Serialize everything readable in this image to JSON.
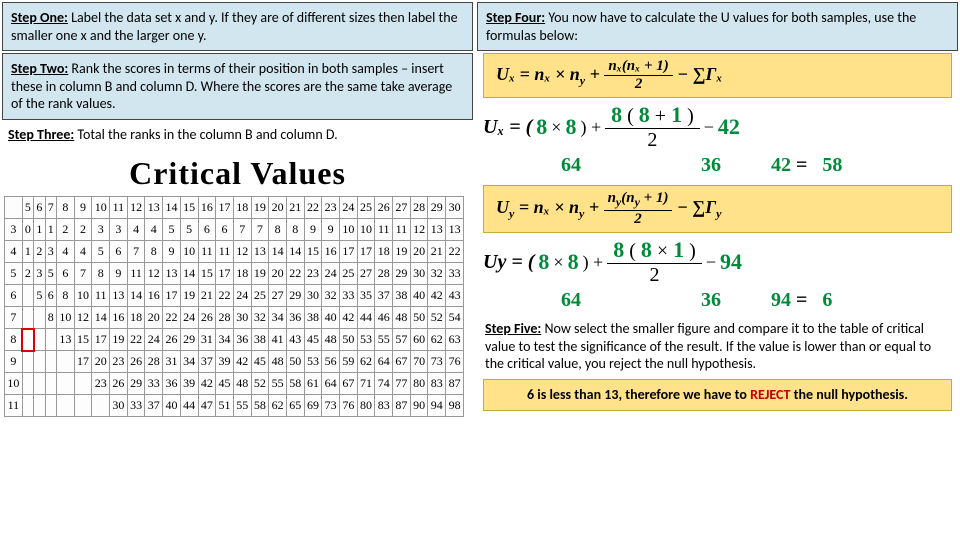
{
  "left": {
    "step1": {
      "label": "Step One:",
      "text": " Label the data set x and y. If they are of different sizes then label the smaller one x and the larger one y."
    },
    "step2": {
      "label": "Step Two:",
      "text": " Rank the scores in terms of their position in both samples – insert these in column B and column D. Where the scores are the same take average of the rank values."
    },
    "step3": {
      "label": "Step Three:",
      "text": " Total the ranks in the column B and column D."
    },
    "critical_title": "Critical Values"
  },
  "table": {
    "header": [
      "5",
      "6",
      "7",
      "8",
      "9",
      "10",
      "11",
      "12",
      "13",
      "14",
      "15",
      "16",
      "17",
      "18",
      "19",
      "20",
      "21",
      "22",
      "23",
      "24",
      "25",
      "26",
      "27",
      "28",
      "29",
      "30"
    ],
    "rows": [
      {
        "h": "3",
        "cells": [
          "0",
          "1",
          "1",
          "2",
          "2",
          "3",
          "3",
          "4",
          "4",
          "5",
          "5",
          "6",
          "6",
          "7",
          "7",
          "8",
          "8",
          "9",
          "9",
          "10",
          "10",
          "11",
          "11",
          "12",
          "13",
          "13"
        ]
      },
      {
        "h": "4",
        "cells": [
          "1",
          "2",
          "3",
          "4",
          "4",
          "5",
          "6",
          "7",
          "8",
          "9",
          "10",
          "11",
          "11",
          "12",
          "13",
          "14",
          "14",
          "15",
          "16",
          "17",
          "17",
          "18",
          "19",
          "20",
          "21",
          "22"
        ]
      },
      {
        "h": "5",
        "cells": [
          "2",
          "3",
          "5",
          "6",
          "7",
          "8",
          "9",
          "11",
          "12",
          "13",
          "14",
          "15",
          "17",
          "18",
          "19",
          "20",
          "22",
          "23",
          "24",
          "25",
          "27",
          "28",
          "29",
          "30",
          "32",
          "33"
        ]
      },
      {
        "h": "6",
        "cells": [
          "",
          "5",
          "6",
          "8",
          "10",
          "11",
          "13",
          "14",
          "16",
          "17",
          "19",
          "21",
          "22",
          "24",
          "25",
          "27",
          "29",
          "30",
          "32",
          "33",
          "35",
          "37",
          "38",
          "40",
          "42",
          "43"
        ]
      },
      {
        "h": "7",
        "cells": [
          "",
          "",
          "8",
          "10",
          "12",
          "14",
          "16",
          "18",
          "20",
          "22",
          "24",
          "26",
          "28",
          "30",
          "32",
          "34",
          "36",
          "38",
          "40",
          "42",
          "44",
          "46",
          "48",
          "50",
          "52",
          "54"
        ]
      },
      {
        "h": "8",
        "cells": [
          "",
          "",
          "",
          "13",
          "15",
          "17",
          "19",
          "22",
          "24",
          "26",
          "29",
          "31",
          "34",
          "36",
          "38",
          "41",
          "43",
          "45",
          "48",
          "50",
          "53",
          "55",
          "57",
          "60",
          "62",
          "63"
        ]
      },
      {
        "h": "9",
        "cells": [
          "",
          "",
          "",
          "",
          "17",
          "20",
          "23",
          "26",
          "28",
          "31",
          "34",
          "37",
          "39",
          "42",
          "45",
          "48",
          "50",
          "53",
          "56",
          "59",
          "62",
          "64",
          "67",
          "70",
          "73",
          "76"
        ]
      },
      {
        "h": "10",
        "cells": [
          "",
          "",
          "",
          "",
          "",
          "23",
          "26",
          "29",
          "33",
          "36",
          "39",
          "42",
          "45",
          "48",
          "52",
          "55",
          "58",
          "61",
          "64",
          "67",
          "71",
          "74",
          "77",
          "80",
          "83",
          "87"
        ]
      },
      {
        "h": "11",
        "cells": [
          "",
          "",
          "",
          "",
          "",
          "",
          "30",
          "33",
          "37",
          "40",
          "44",
          "47",
          "51",
          "55",
          "58",
          "62",
          "65",
          "69",
          "73",
          "76",
          "80",
          "83",
          "87",
          "90",
          "94",
          "98"
        ]
      }
    ],
    "highlight_row": 5,
    "highlight_col": 0
  },
  "right": {
    "step4": {
      "label": "Step Four:",
      "text": " You now have to calculate the U values for both samples, use the formulas below:"
    },
    "formula_ux": {
      "lhs": "Uₓ = nₓ × n",
      "sub_y": "y",
      "plus": " + ",
      "frac_num": "nₓ(nₓ + 1)",
      "frac_den": "2",
      "minus_sum": " − ∑Γₓ"
    },
    "calc_ux": {
      "lhs": "Uₓ = (",
      "n1": "8",
      "times": " × ",
      "n2": "8",
      "rp_plus": " ) + ",
      "num_a": "8",
      "num_lp": " ( ",
      "num_b": "8",
      "num_plus": " + ",
      "num_c": "1",
      "num_rp": " )",
      "den": "2",
      "minus": " − ",
      "sum": "42",
      "r1": "64",
      "r2": "36",
      "r3": "42",
      "eq": " = ",
      "result": "58"
    },
    "formula_uy": {
      "lhs": "U",
      "sub_y1": "y",
      "eq": " = nₓ × n",
      "sub_y2": "y",
      "plus": " + ",
      "frac_num_a": "n",
      "frac_num_b": "(n",
      "frac_num_c": " + 1)",
      "frac_den": "2",
      "minus_sum": " − ∑Γ",
      "sub_y3": "y"
    },
    "calc_uy": {
      "lhs": "U",
      "sub_y": "y",
      "eq_lp": " = ( ",
      "n1": "8",
      "times": " × ",
      "n2": "8",
      "rp_plus": " ) + ",
      "num_a": "8",
      "num_lp": " ( ",
      "num_b": "8",
      "num_times": " × ",
      "num_c": "1",
      "num_rp": " )",
      "den": "2",
      "minus": " − ",
      "sum": "94",
      "r1": "64",
      "r2": "36",
      "r3": "94",
      "eq2": " = ",
      "result": "6"
    },
    "step5": {
      "label": "Step Five:",
      "text": " Now select the smaller figure and compare it to the table of critical value to test the significance of the result. If the value is lower than or equal to the critical value, you reject the null hypothesis."
    },
    "conclusion": {
      "a": "6 is less than 13, therefore we have to ",
      "reject": "REJECT",
      "b": " the null hypothesis."
    }
  }
}
